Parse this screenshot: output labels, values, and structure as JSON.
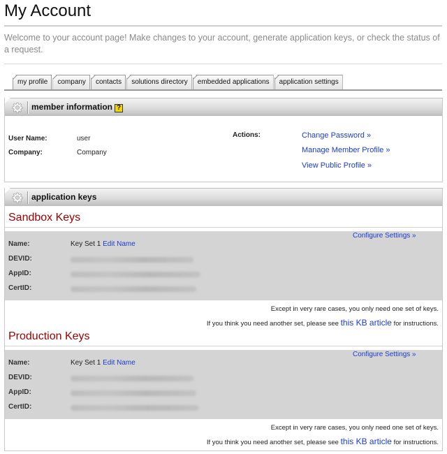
{
  "page": {
    "title": "My Account",
    "welcome": "Welcome to your account page! Make changes to your account, generate application keys, or check the status of a request."
  },
  "tabs": [
    {
      "label": "my profile"
    },
    {
      "label": "company"
    },
    {
      "label": "contacts"
    },
    {
      "label": "solutions directory"
    },
    {
      "label": "embedded applications"
    },
    {
      "label": "application settings"
    }
  ],
  "member_info": {
    "header": "member information",
    "help_glyph": "?",
    "fields": [
      {
        "label": "User Name:",
        "value": "user"
      },
      {
        "label": "Company:",
        "value": "Company"
      }
    ],
    "actions_label": "Actions:",
    "actions": [
      {
        "label": "Change Password »"
      },
      {
        "label": "Manage Member Profile »"
      },
      {
        "label": "View Public Profile »"
      }
    ]
  },
  "app_keys": {
    "header": "application keys",
    "sandbox": {
      "heading": "Sandbox Keys",
      "configure": "Configure Settings »",
      "name_label": "Name:",
      "name_value": "Key Set 1",
      "edit_label": "Edit Name",
      "devid_label": "DEVID:",
      "appid_label": "AppID:",
      "certid_label": "CertID:",
      "note1": "Except in very rare cases, you only need one set of keys.",
      "note2_pre": "If you think you need another set, please see ",
      "note2_link": "this KB article",
      "note2_post": " for instructions."
    },
    "production": {
      "heading": "Production Keys",
      "configure": "Configure Settings »",
      "name_label": "Name:",
      "name_value": "Key Set 1",
      "edit_label": "Edit Name",
      "devid_label": "DEVID:",
      "appid_label": "AppID:",
      "certid_label": "CertID:",
      "note1": "Except in very rare cases, you only need one set of keys.",
      "note2_pre": "If you think you need another set, please see ",
      "note2_link": "this KB article",
      "note2_post": " for instructions."
    }
  },
  "colors": {
    "link": "#1a3ccf",
    "heading_red": "#990000",
    "key_block_bg": "#d4d4d4",
    "help_icon": "#f5d400"
  }
}
